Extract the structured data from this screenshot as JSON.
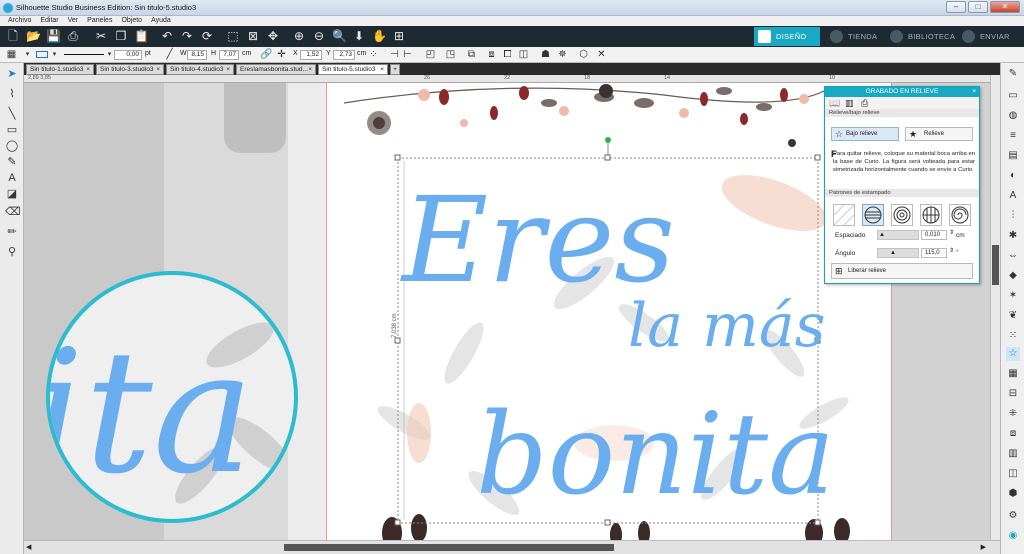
{
  "window": {
    "title": "Silhouette Studio Business Edition: Sin titulo-5.studio3"
  },
  "menu": [
    "Archivo",
    "Editar",
    "Ver",
    "Paneles",
    "Objeto",
    "Ayuda"
  ],
  "modes": [
    {
      "label": "DISEÑO",
      "active": true
    },
    {
      "label": "TIENDA",
      "active": false
    },
    {
      "label": "BIBLIOTECA",
      "active": false
    },
    {
      "label": "ENVIAR",
      "active": false
    }
  ],
  "props": {
    "line_width": "0,00",
    "line_unit": "pt",
    "w_label": "W",
    "w_value": "8,15",
    "h_label": "H",
    "h_value": "7,07",
    "size_unit": "cm",
    "x_label": "X",
    "x_value": "1,52",
    "y_label": "Y",
    "y_value": "2,73",
    "pos_unit": "cm"
  },
  "tabs": [
    {
      "label": "Sin titulo-1.studio3",
      "active": false
    },
    {
      "label": "Sin titulo-3.studio3",
      "active": false
    },
    {
      "label": "Sin titulo-4.studio3",
      "active": false
    },
    {
      "label": "Ereslamasbonita.stud...",
      "active": false
    },
    {
      "label": "Sin titulo-5.studio3",
      "active": true
    }
  ],
  "ruler": {
    "ticks": [
      "26",
      "22",
      "18",
      "14",
      "10"
    ],
    "readout": "2,89  3,85"
  },
  "design": {
    "words": [
      "Eres",
      "la más",
      "bonita"
    ],
    "zoom_text": "ita",
    "dimension_label": "7,038 cm",
    "text_color": "#6aaef0"
  },
  "panel": {
    "title": "GRABADO EN RELIEVE",
    "section1": "Relieve/bajo relieve",
    "btn_bajo": "Bajo relieve",
    "btn_relieve": "Relieve",
    "description": "Para quitar relieve, coloque su material boca arriba en la base de Curio. La figura será volteada para estar simetrizada horizontalmente cuando se envíe a Curio.",
    "section2": "Patrones de estampado",
    "espaciado_label": "Espaciado",
    "espaciado_value": "0,010",
    "espaciado_unit": "cm",
    "angulo_label": "Ángulo",
    "angulo_value": "115,0",
    "angulo_unit": "°",
    "liberar_label": "Liberar relieve"
  },
  "colors": {
    "accent": "#1aa9c4",
    "toolbar": "#1e2a31",
    "lettering": "#6aaef0",
    "zoom_ring": "#2bbcd0"
  }
}
